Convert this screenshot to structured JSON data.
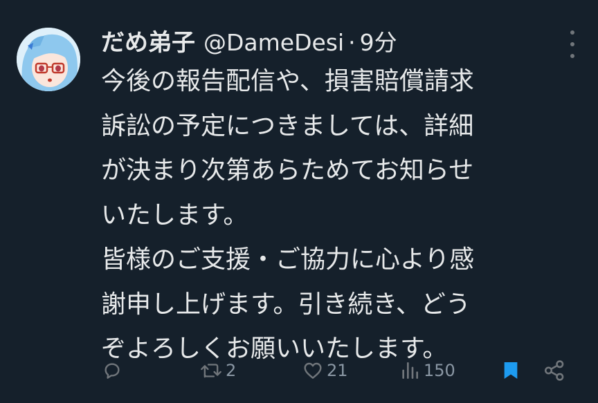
{
  "tweet": {
    "display_name": "だめ弟子",
    "handle": "@DameDesi",
    "separator": "·",
    "time": "9分",
    "text": "今後の報告配信や、損害賠償請求\n訴訟の予定につきましては、詳細\nが決まり次第あらためてお知らせ\nいたします。\n皆様のご支援・ご協力に心より感\n謝申し上げます。引き続き、どう\nぞよろしくお願いいたします。"
  },
  "actions": {
    "reply_count": "",
    "retweet_count": "2",
    "like_count": "21",
    "view_count": "150"
  },
  "colors": {
    "background": "#15202b",
    "text": "#e7e9ea",
    "muted": "#71767b",
    "bookmark_active": "#1d9bf0"
  },
  "icons": [
    "more-icon",
    "reply-icon",
    "retweet-icon",
    "like-icon",
    "views-icon",
    "bookmark-icon",
    "share-icon"
  ]
}
